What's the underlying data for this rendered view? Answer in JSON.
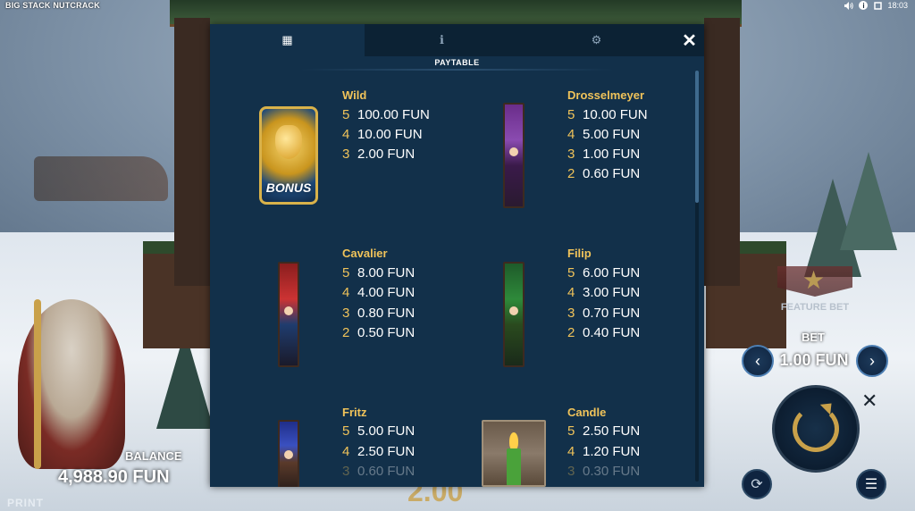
{
  "game": {
    "title": "BIG STACK NUTCRACK"
  },
  "status": {
    "time": "18:03",
    "sound_icon": "speaker-icon",
    "info_icon": "info-icon",
    "fullscreen_icon": "fullscreen-icon"
  },
  "modal": {
    "tabs": [
      {
        "icon": "paytable-icon",
        "glyph": "▦"
      },
      {
        "icon": "info-icon",
        "glyph": "ℹ"
      },
      {
        "icon": "gear-icon",
        "glyph": "⚙"
      }
    ],
    "close_glyph": "✕",
    "title": "PAYTABLE",
    "symbols": [
      {
        "name": "Wild",
        "image_text": "BONUS",
        "pays": [
          {
            "count": "5",
            "value": "100.00 FUN"
          },
          {
            "count": "4",
            "value": "10.00 FUN"
          },
          {
            "count": "3",
            "value": "2.00 FUN"
          }
        ]
      },
      {
        "name": "Drosselmeyer",
        "pays": [
          {
            "count": "5",
            "value": "10.00 FUN"
          },
          {
            "count": "4",
            "value": "5.00 FUN"
          },
          {
            "count": "3",
            "value": "1.00 FUN"
          },
          {
            "count": "2",
            "value": "0.60 FUN"
          }
        ]
      },
      {
        "name": "Cavalier",
        "pays": [
          {
            "count": "5",
            "value": "8.00 FUN"
          },
          {
            "count": "4",
            "value": "4.00 FUN"
          },
          {
            "count": "3",
            "value": "0.80 FUN"
          },
          {
            "count": "2",
            "value": "0.50 FUN"
          }
        ]
      },
      {
        "name": "Filip",
        "pays": [
          {
            "count": "5",
            "value": "6.00 FUN"
          },
          {
            "count": "4",
            "value": "3.00 FUN"
          },
          {
            "count": "3",
            "value": "0.70 FUN"
          },
          {
            "count": "2",
            "value": "0.40 FUN"
          }
        ]
      },
      {
        "name": "Fritz",
        "pays": [
          {
            "count": "5",
            "value": "5.00 FUN"
          },
          {
            "count": "4",
            "value": "2.50 FUN"
          },
          {
            "count": "3",
            "value": "0.60 FUN"
          }
        ]
      },
      {
        "name": "Candle",
        "pays": [
          {
            "count": "5",
            "value": "2.50 FUN"
          },
          {
            "count": "4",
            "value": "1.20 FUN"
          },
          {
            "count": "3",
            "value": "0.30 FUN"
          }
        ]
      }
    ]
  },
  "controls": {
    "feature_bet_label": "FEATURE BET",
    "bet_label": "BET",
    "bet_value": "1.00 FUN",
    "bet_minus_glyph": "‹",
    "bet_plus_glyph": "›",
    "autoplay_glyph": "⟳",
    "menu_glyph": "☰",
    "turbo_glyph": "✕"
  },
  "balance": {
    "label": "BALANCE",
    "value": "4,988.90 FUN"
  },
  "win_ghost": "2.00",
  "print_label": "PRINT",
  "colors": {
    "accent": "#f0c35a",
    "panel": "#12304a",
    "tabbar": "#0c2234"
  }
}
